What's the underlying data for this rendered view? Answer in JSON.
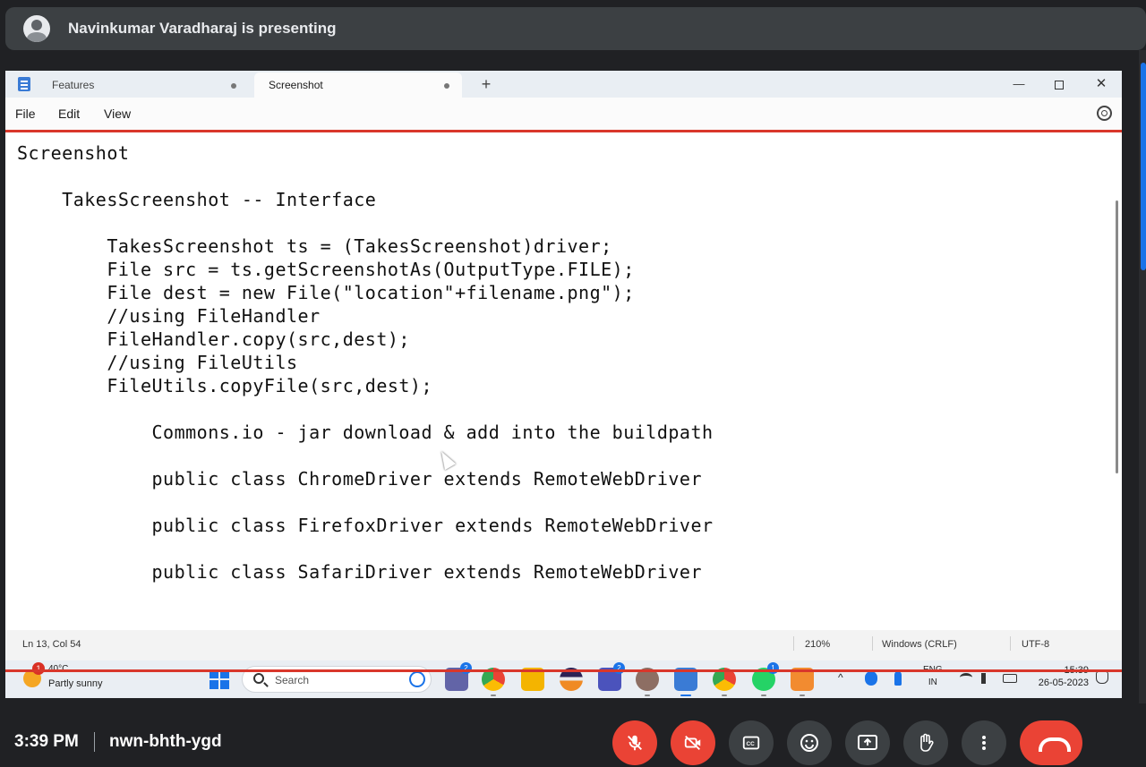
{
  "meet": {
    "presenter_text": "Navinkumar Varadharaj is presenting",
    "time": "3:39 PM",
    "meeting_code": "nwn-bhth-ygd",
    "controls": [
      "mic-off-icon",
      "camera-off-icon",
      "captions-icon",
      "emoji-icon",
      "present-icon",
      "raise-hand-icon",
      "more-options-icon",
      "end-call-icon"
    ],
    "accent_red": "#ea4335"
  },
  "notepad": {
    "tabs": [
      {
        "label": "Features"
      },
      {
        "label": "Screenshot"
      }
    ],
    "new_tab": "+",
    "window": {
      "minimize": "—",
      "close": "✕"
    },
    "menu": {
      "file": "File",
      "edit": "Edit",
      "view": "View"
    },
    "content": [
      "Screenshot",
      "",
      "    TakesScreenshot -- Interface",
      "",
      "        TakesScreenshot ts = (TakesScreenshot)driver;",
      "        File src = ts.getScreenshotAs(OutputType.FILE);",
      "        File dest = new File(\"location\"+filename.png\");",
      "        //using FileHandler",
      "        FileHandler.copy(src,dest);",
      "        //using FileUtils",
      "        FileUtils.copyFile(src,dest);",
      "",
      "            Commons.io - jar download & add into the buildpath",
      "",
      "            public class ChromeDriver extends RemoteWebDriver",
      "",
      "            public class FirefoxDriver extends RemoteWebDriver",
      "",
      "            public class SafariDriver extends RemoteWebDriver"
    ],
    "status": {
      "position": "Ln 13, Col 54",
      "zoom": "210%",
      "line_ending": "Windows (CRLF)",
      "encoding": "UTF-8"
    }
  },
  "taskbar": {
    "weather_temp": "40°C",
    "weather_desc": "Partly sunny",
    "weather_badge": "1",
    "search_placeholder": "Search",
    "lang_line1": "ENG",
    "lang_line2": "IN",
    "clock_time": "15:39",
    "clock_date": "26-05-2023",
    "badges": {
      "teams_chat": "2",
      "teams": "2",
      "whatsapp": "1"
    }
  }
}
